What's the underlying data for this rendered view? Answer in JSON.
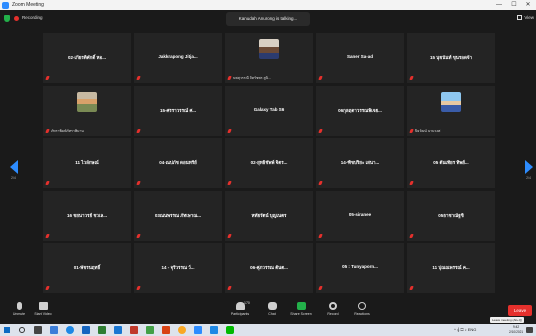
{
  "window": {
    "title": "Zoom Meeting",
    "controls": [
      "—",
      "☐",
      "✕"
    ]
  },
  "topbar": {
    "recording_label": "Recording",
    "talking_text": "Kanudah Anurong is talking...",
    "view_label": "View"
  },
  "nav": {
    "left_page": "2/4",
    "right_page": "2/4"
  },
  "participants": [
    {
      "name": "02-เกียรติศักดิ์ หอ...",
      "tag": ""
    },
    {
      "name": "Jakkrapong Jitja...",
      "tag": ""
    },
    {
      "name": "",
      "tag": "นพสุวรรณี จิตรัชพร สูนิ...",
      "avatar": "av-1"
    },
    {
      "name": "Saner Sa-ad",
      "tag": ""
    },
    {
      "name": "15 นุชนันท์ ขุนรอดจ้า",
      "tag": ""
    },
    {
      "name": "",
      "tag": "ภัทราพิมพ์ภัทราพิมาน",
      "avatar": "av-2"
    },
    {
      "name": "15-ศรราวรรณ์ ศ...",
      "tag": ""
    },
    {
      "name": "Galaxy Tab S6",
      "tag": ""
    },
    {
      "name": "06กุลฤดาวรรณพิเจย...",
      "tag": ""
    },
    {
      "name": "",
      "tag": "ปิยวัฒน์ นามวงศ",
      "avatar": "av-3"
    },
    {
      "name": "11 ไวลักษณ์",
      "tag": ""
    },
    {
      "name": "04-ณปภัช ดอนทรีย์",
      "tag": ""
    },
    {
      "name": "02-ยุทธิชัพพ์ จิตร...",
      "tag": ""
    },
    {
      "name": "14-ฑิชปริยะ เสนา...",
      "tag": ""
    },
    {
      "name": "05 ต้นเทียร ทิพย์...",
      "tag": ""
    },
    {
      "name": "16 ชยนาวรย์ ชวเล...",
      "tag": ""
    },
    {
      "name": "03ณนพรรณ ภัทเษาณ...",
      "tag": ""
    },
    {
      "name": "หทัยรัตน์ บุญเนตร",
      "tag": ""
    },
    {
      "name": "05-siranee",
      "tag": ""
    },
    {
      "name": "05ธาชาณัฐชิ",
      "tag": ""
    },
    {
      "name": "01-พัชรนฤทธิ์",
      "tag": ""
    },
    {
      "name": "14 - จุรีวรรณ ว์...",
      "tag": ""
    },
    {
      "name": "06-ศุภวรรณ ต้นต...",
      "tag": ""
    },
    {
      "name": "05 : Tunyaporn...",
      "tag": ""
    },
    {
      "name": "11 ปุณณพรรณ์ ค...",
      "tag": ""
    }
  ],
  "controls": {
    "unmute": "Unmute",
    "start_video": "Start Video",
    "participants": "Participants",
    "participant_count": "170",
    "chat": "Chat",
    "share_screen": "Share Screen",
    "record": "Record",
    "reactions": "Reactions",
    "leave": "Leave",
    "leave_tooltip": "Leave meeting (Alt+Q)"
  },
  "taskbar": {
    "system_tray": "^ 𝄞 ☐ ♪ ENG",
    "time": "9:42",
    "date": "2/10/2021"
  },
  "colors": {
    "accent": "#2d8cff",
    "record": "#e5302c",
    "share": "#23b04a",
    "tile": "#242424",
    "background": "#1a1a1a"
  }
}
